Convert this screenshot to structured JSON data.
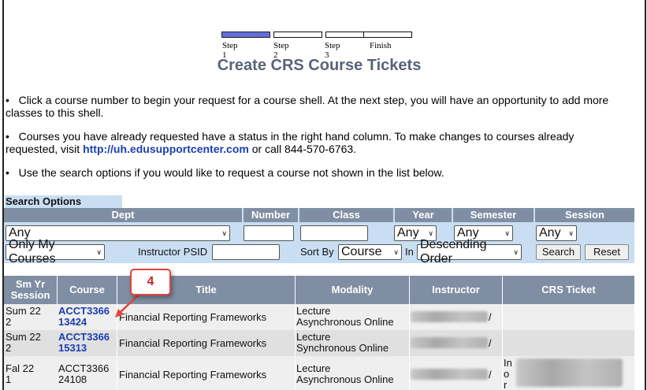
{
  "steps": [
    {
      "label": "Step 1",
      "active": true
    },
    {
      "label": "Step 2",
      "active": false
    },
    {
      "label": "Step 3",
      "active": false
    },
    {
      "label": "Finish",
      "active": false
    }
  ],
  "page_title": "Create CRS Course Tickets",
  "instructions": {
    "bullet1": "Click a course number to begin your request for a course shell. At the next step, you will have an opportunity to add more classes to this shell.",
    "bullet2_pre": "Courses you have already requested have a status in the right hand column. To make changes to courses already requested, visit ",
    "bullet2_link": "http://uh.edusupportcenter.com",
    "bullet2_post": " or call 844-570-6763.",
    "bullet3": "Use the search options if you would like to request a course not shown in the list below.",
    "bullet_char": "•"
  },
  "search": {
    "section_label": "Search Options",
    "headers": {
      "dept": "Dept",
      "number": "Number",
      "class": "Class",
      "year": "Year",
      "semester": "Semester",
      "session": "Session"
    },
    "dept_value": "Any",
    "number_value": "",
    "class_value": "",
    "year_value": "Any",
    "semester_value": "Any",
    "session_value": "Any",
    "scope_value": "Only My Courses",
    "instructor_label": "Instructor PSID",
    "instructor_value": "",
    "sortby_label": "Sort By",
    "sortby_value": "Course",
    "in_label": "In",
    "order_value": "Descending Order",
    "search_button": "Search",
    "reset_button": "Reset"
  },
  "table": {
    "headers": {
      "session_line1": "Sm Yr",
      "session_line2": "Session",
      "course": "Course",
      "title": "Title",
      "modality": "Modality",
      "instructor": "Instructor",
      "ticket": "CRS Ticket"
    },
    "rows": [
      {
        "session_a": "Sum 22",
        "session_b": "2",
        "course_a": "ACCT3366",
        "course_b": "13424",
        "course_link": true,
        "title": "Financial Reporting Frameworks",
        "modality_a": "Lecture",
        "modality_b": "Asynchronous Online",
        "instructor_tail": "/",
        "ticket": ""
      },
      {
        "session_a": "Sum 22",
        "session_b": "2",
        "course_a": "ACCT3366",
        "course_b": "15313",
        "course_link": true,
        "title": "Financial Reporting Frameworks",
        "modality_a": "Lecture",
        "modality_b": "Synchronous Online",
        "instructor_tail": "/",
        "ticket": ""
      },
      {
        "session_a": "Fal 22",
        "session_b": "1",
        "course_a": "ACCT3366",
        "course_b": "24108",
        "course_link": false,
        "title": "Financial Reporting Frameworks",
        "modality_a": "Lecture",
        "modality_b": "Asynchronous Online",
        "instructor_tail": "/",
        "ticket_a": "In",
        "ticket_b": "o",
        "ticket_c": "r"
      }
    ]
  },
  "callout": {
    "number": "4",
    "color": "#e0443a"
  },
  "colors": {
    "header_bg": "#7f8ea3",
    "panel_bg": "#c9def2",
    "link": "#1a3fb0",
    "title": "#5a6378"
  }
}
